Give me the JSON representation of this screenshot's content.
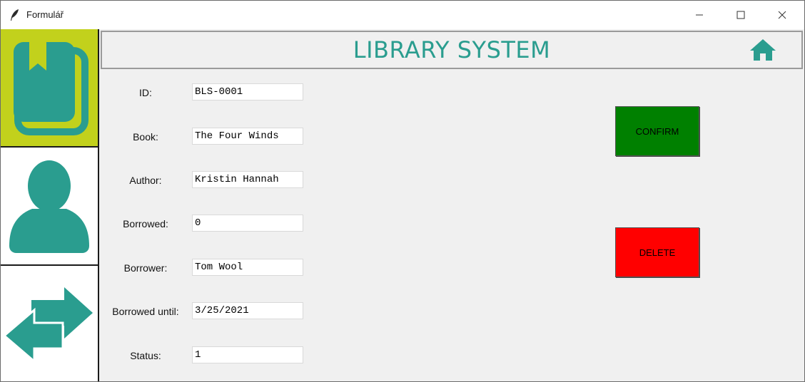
{
  "window": {
    "title": "Formulář",
    "app_icon": "feather-icon",
    "controls": [
      "minimize-icon",
      "maximize-icon",
      "close-icon"
    ]
  },
  "sidebar": {
    "items": [
      {
        "id": "books",
        "icon": "book-icon",
        "active": true
      },
      {
        "id": "users",
        "icon": "user-icon",
        "active": false
      },
      {
        "id": "transfers",
        "icon": "arrows-exchange-icon",
        "active": false
      }
    ]
  },
  "header": {
    "title": "LIBRARY SYSTEM",
    "home_icon": "home-icon"
  },
  "form": {
    "id": {
      "label": "ID:",
      "value": "BLS-0001"
    },
    "book": {
      "label": "Book:",
      "value": "The Four Winds"
    },
    "author": {
      "label": "Author:",
      "value": "Kristin Hannah"
    },
    "borrowed": {
      "label": "Borrowed:",
      "value": "0"
    },
    "borrower": {
      "label": "Borrower:",
      "value": "Tom Wool"
    },
    "borrowed_until": {
      "label": "Borrowed until:",
      "value": "3/25/2021"
    },
    "status": {
      "label": "Status:",
      "value": "1"
    }
  },
  "actions": {
    "confirm_label": "CONFIRM",
    "delete_label": "DELETE"
  },
  "colors": {
    "accent": "#2a9d8f",
    "sidebar_active": "#c2d11c",
    "confirm": "#008000",
    "delete": "#ff0000"
  }
}
